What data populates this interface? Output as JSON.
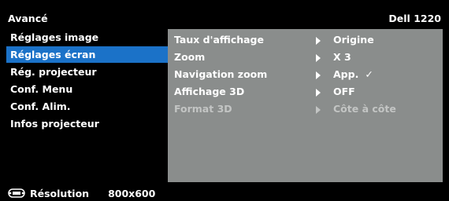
{
  "header": {
    "title": "Avancé",
    "model": "Dell 1220"
  },
  "sidebar": {
    "items": [
      {
        "label": "Réglages image"
      },
      {
        "label": "Réglages écran"
      },
      {
        "label": "Rég. projecteur"
      },
      {
        "label": "Conf. Menu"
      },
      {
        "label": "Conf. Alim."
      },
      {
        "label": "Infos projecteur"
      }
    ],
    "selected_index": 1
  },
  "content": {
    "rows": [
      {
        "label": "Taux d'affichage",
        "value": "Origine"
      },
      {
        "label": "Zoom",
        "value": "X 3"
      },
      {
        "label": "Navigation zoom",
        "value": "App.",
        "check": "✓"
      },
      {
        "label": "Affichage 3D",
        "value": "OFF"
      },
      {
        "label": "Format 3D",
        "value": "Côte à côte",
        "disabled": true
      }
    ]
  },
  "footer": {
    "resolution_label": "Résolution",
    "resolution_value": "800x600"
  },
  "colors": {
    "accent": "#1b72c8",
    "panel": "#8a8d8c",
    "background": "#000000"
  },
  "icons": {
    "resolution": "monitor-connector-icon",
    "arrow": "right-triangle-icon",
    "check": "checkmark-icon"
  }
}
